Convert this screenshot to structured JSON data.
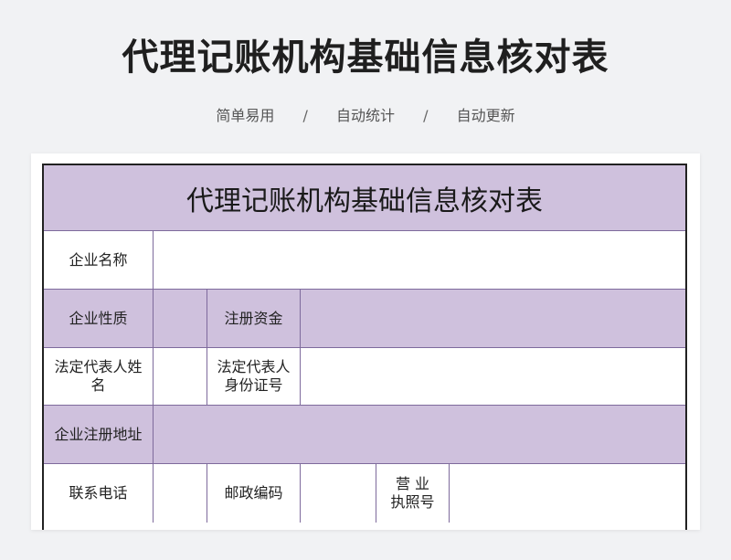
{
  "header": {
    "title": "代理记账机构基础信息核对表",
    "tags": [
      "简单易用",
      "自动统计",
      "自动更新"
    ],
    "separator": "/"
  },
  "sheet": {
    "title": "代理记账机构基础信息核对表",
    "labels": {
      "company_name": "企业名称",
      "company_nature": "企业性质",
      "registered_capital": "注册资金",
      "legal_rep_name": "法定代表人姓名",
      "legal_rep_id": "法定代表人身份证号",
      "registered_address": "企业注册地址",
      "phone": "联系电话",
      "postal_code": "邮政编码",
      "business_license_line1": "营 业",
      "business_license_line2": "执照号"
    }
  },
  "colors": {
    "header_fill": "#cfc1dd",
    "grid_line": "#7e6a9c",
    "page_background": "#f1f2f4"
  }
}
